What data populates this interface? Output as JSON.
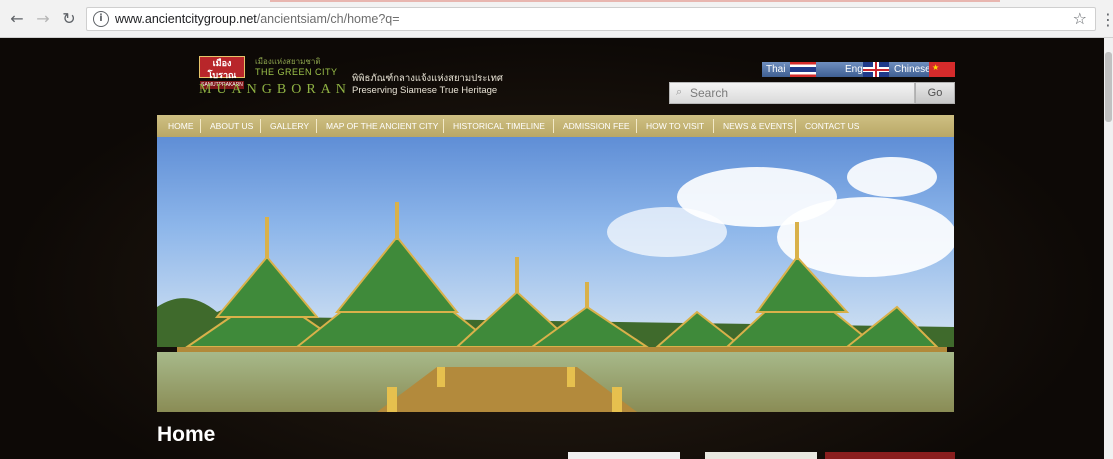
{
  "browser": {
    "url_host": "www.ancientcitygroup.net",
    "url_path": "/ancientsiam/ch/home?q="
  },
  "header": {
    "logo_thai": "เมืองโบราณ",
    "logo_sub": "SAMUTPRAKARN",
    "thai_small": "เมืองแห่งสยามชาติ",
    "green_city": "THE GREEN CITY",
    "brand": "MUANGBORAN",
    "thai_tagline": "พิพิธภัณฑ์กลางแจ้งแห่งสยามประเทศ",
    "tagline": "Preserving Siamese True Heritage"
  },
  "languages": {
    "thai": "Thai",
    "english": "English",
    "chinese": "Chinese"
  },
  "search": {
    "placeholder": "Search",
    "go_label": "Go"
  },
  "nav": [
    "HOME",
    "ABOUT US",
    "GALLERY",
    "MAP OF THE ANCIENT CITY",
    "HISTORICAL TIMELINE",
    "ADMISSION FEE",
    "HOW TO VISIT",
    "NEWS & EVENTS",
    "CONTACT US"
  ],
  "main": {
    "heading": "Home"
  },
  "colors": {
    "nav_gold": "#c4b474",
    "brand_green": "#8fb243",
    "logo_red": "#b8262a"
  }
}
